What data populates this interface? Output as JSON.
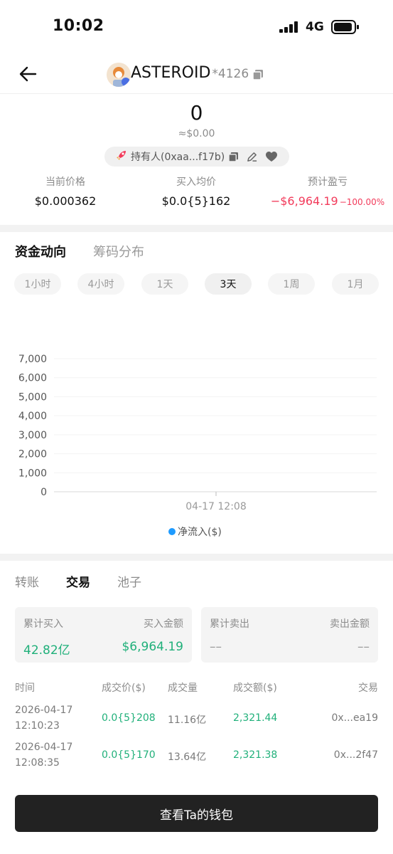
{
  "status_bar": {
    "time": "10:02",
    "network": "4G"
  },
  "header": {
    "title": "ASTEROID",
    "suffix": "*4126"
  },
  "balance": {
    "amount": "0",
    "usd": "≈$0.00"
  },
  "holder": {
    "label": "持有人(0xaa...f17b)"
  },
  "stats": [
    {
      "label": "当前价格",
      "value": "$0.000362"
    },
    {
      "label": "买入均价",
      "value": "$0.0{5}162"
    },
    {
      "label": "预计盈亏",
      "value": "−$6,964.19",
      "pct": "−100.00%"
    }
  ],
  "chart_tabs": [
    {
      "label": "资金动向",
      "active": true
    },
    {
      "label": "筹码分布",
      "active": false
    }
  ],
  "ranges": [
    {
      "label": "1小时",
      "active": false
    },
    {
      "label": "4小时",
      "active": false
    },
    {
      "label": "1天",
      "active": false
    },
    {
      "label": "3天",
      "active": true
    },
    {
      "label": "1周",
      "active": false
    },
    {
      "label": "1月",
      "active": false
    }
  ],
  "chart_data": {
    "type": "line",
    "y_ticks": [
      "7,000",
      "6,000",
      "5,000",
      "4,000",
      "3,000",
      "2,000",
      "1,000",
      "0"
    ],
    "ylim": [
      0,
      7000
    ],
    "x_ticks": [
      "04-17 12:08"
    ],
    "series": [
      {
        "name": "净流入($)",
        "color": "#1e9bff",
        "values": []
      }
    ],
    "legend": "bottom-center",
    "grid": true
  },
  "trade_tabs": [
    {
      "label": "转账",
      "active": false
    },
    {
      "label": "交易",
      "active": true
    },
    {
      "label": "池子",
      "active": false
    }
  ],
  "buy_card": {
    "label_left": "累计买入",
    "label_right": "买入金额",
    "value_left": "42.82亿",
    "value_right": "$6,964.19"
  },
  "sell_card": {
    "label_left": "累计卖出",
    "label_right": "卖出金额",
    "value_left": "––",
    "value_right": "––"
  },
  "table": {
    "headers": [
      "时间",
      "成交价($)",
      "成交量",
      "成交额($)",
      "交易"
    ],
    "rows": [
      {
        "date": "2026-04-17",
        "time": "12:10:23",
        "price": "0.0{5}208",
        "volume": "11.16亿",
        "amount": "2,321.44",
        "tx": "0x...ea19"
      },
      {
        "date": "2026-04-17",
        "time": "12:08:35",
        "price": "0.0{5}170",
        "volume": "13.64亿",
        "amount": "2,321.38",
        "tx": "0x...2f47"
      }
    ]
  },
  "wallet_button": {
    "label": "查看Ta的钱包"
  },
  "colors": {
    "negative": "#f23b5b",
    "positive": "#20b07a",
    "series": "#1e9bff",
    "button": "#222222"
  }
}
